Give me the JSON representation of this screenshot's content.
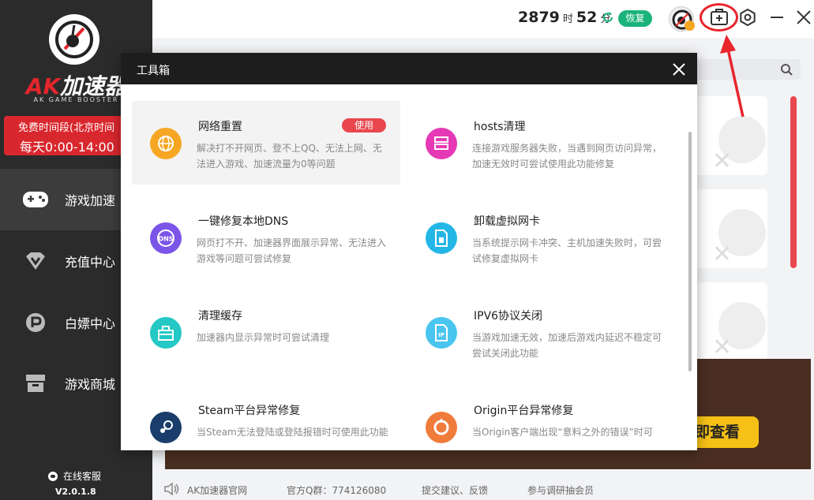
{
  "app": {
    "logo_brand": "AK",
    "logo_name": "加速器",
    "logo_sub": "AK GAME BOOSTER",
    "free_banner_line1": "免费时间段(北京时间",
    "free_banner_line2": "每天0:00-14:00",
    "support": "在线客服",
    "version": "V2.0.1.8"
  },
  "sidebar": {
    "items": [
      {
        "label": "游戏加速",
        "icon": "gamepad-icon",
        "active": true
      },
      {
        "label": "充值中心",
        "icon": "diamond-icon",
        "active": false
      },
      {
        "label": "白嫖中心",
        "icon": "p-coin-icon",
        "active": false
      },
      {
        "label": "游戏商城",
        "icon": "store-icon",
        "active": false
      }
    ]
  },
  "topbar": {
    "hours": "2879",
    "hours_unit": "时",
    "minutes": "52",
    "minutes_unit": "分",
    "restore": "恢复"
  },
  "banner": {
    "button": "即查看"
  },
  "footer": {
    "official_site": "AK加速器官网",
    "qq_group": "官方Q群：774126080",
    "feedback": "提交建议、反馈",
    "survey": "参与调研抽会员"
  },
  "dialog": {
    "title": "工具箱",
    "tools": [
      {
        "title": "网络重置",
        "desc": "解决打不开网页、登不上QQ、无法上网、无法进入游戏、加速流量为0等问题",
        "button": "使用",
        "icon": "globe-icon",
        "color": "#f6a623"
      },
      {
        "title": "hosts清理",
        "desc": "连接游戏服务器失败，当遇到网页访问异常，加速无效时可尝试使用此功能修复",
        "icon": "server-icon",
        "color": "#e639b5"
      },
      {
        "title": "一键修复本地DNS",
        "desc": "网页打不开、加速器界面展示异常、无法进入游戏等问题可尝试修复",
        "icon": "dns-icon",
        "color": "#7b55e8"
      },
      {
        "title": "卸载虚拟网卡",
        "desc": "当系统提示网卡冲突、主机加速失败时，可尝试修复虚拟网卡",
        "icon": "sim-card-icon",
        "color": "#25b6e8"
      },
      {
        "title": "清理缓存",
        "desc": "加速器内显示异常时可尝试清理",
        "icon": "cache-box-icon",
        "color": "#24c8c4"
      },
      {
        "title": "IPV6协议关闭",
        "desc": "当游戏加速无效，加速后游戏内延迟不稳定可尝试关闭此功能",
        "icon": "ip-file-icon",
        "color": "#49c5ef"
      },
      {
        "title": "Steam平台异常修复",
        "desc": "当Steam无法登陆或登陆报错时可使用此功能",
        "icon": "steam-icon",
        "color": "#1a3d6b"
      },
      {
        "title": "Origin平台异常修复",
        "desc": "当Origin客户端出现“意料之外的错误”时可",
        "icon": "origin-icon",
        "color": "#f07c3c"
      }
    ]
  }
}
